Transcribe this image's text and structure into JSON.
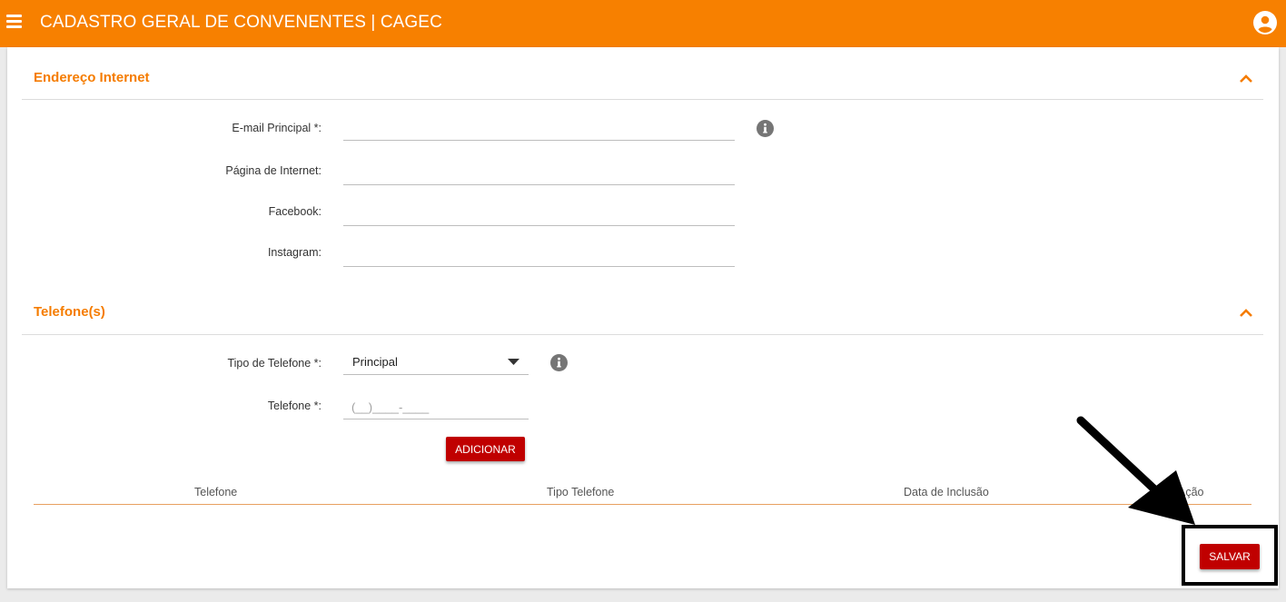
{
  "header": {
    "title": "CADASTRO GERAL DE CONVENENTES | CAGEC",
    "menu_icon": "hamburger-menu-icon",
    "user_icon": "account-circle-icon",
    "background_color": "#f78000"
  },
  "internet_section": {
    "title": "Endereço Internet",
    "collapse_icon": "chevron-up-icon",
    "fields": {
      "email_label": "E-mail Principal *:",
      "email_value": "",
      "website_label": "Página de Internet:",
      "website_value": "",
      "facebook_label": "Facebook:",
      "facebook_value": "",
      "instagram_label": "Instagram:",
      "instagram_value": ""
    },
    "info_icon": "info-icon"
  },
  "phone_section": {
    "title": "Telefone(s)",
    "collapse_icon": "chevron-up-icon",
    "type_label": "Tipo de Telefone *:",
    "type_value": "Principal",
    "phone_label": "Telefone *:",
    "phone_placeholder": "(__)____-____",
    "add_button": "ADICIONAR",
    "table": {
      "columns": [
        "Telefone",
        "Tipo Telefone",
        "Data de Inclusão",
        "Ação"
      ],
      "rows": []
    }
  },
  "footer": {
    "save_button": "SALVAR"
  },
  "colors": {
    "accent": "#f57c00",
    "button": "#c00000"
  }
}
